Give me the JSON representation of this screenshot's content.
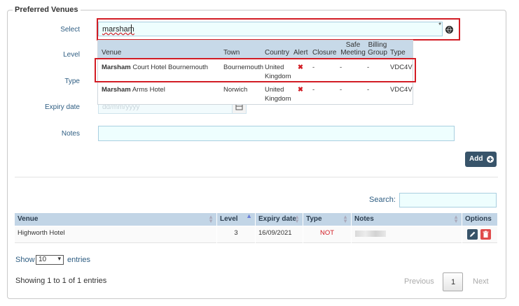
{
  "legend": "Preferred Venues",
  "form": {
    "select_label": "Select",
    "select_value": "marsham",
    "level_label": "Level",
    "type_label": "Type",
    "expiry_label": "Expiry date",
    "expiry_placeholder": "dd/mm/yyyy",
    "notes_label": "Notes",
    "add_label": "Add"
  },
  "dropdown": {
    "headers": {
      "venue": "Venue",
      "town": "Town",
      "country": "Country",
      "alert": "Alert",
      "closure": "Closure",
      "safe_meeting": "Safe Meeting",
      "billing_group": "Billing Group",
      "type": "Type"
    },
    "rows": [
      {
        "venue_bold": "Marsham",
        "venue_rest": " Court Hotel Bournemouth",
        "town": "Bournemouth",
        "country": "United Kingdom",
        "alert": "✖",
        "closure": "-",
        "safe": "-",
        "billing": "-",
        "type": "VDC4V"
      },
      {
        "venue_bold": "Marsham",
        "venue_rest": " Arms Hotel",
        "town": "Norwich",
        "country": "United Kingdom",
        "alert": "✖",
        "closure": "-",
        "safe": "-",
        "billing": "-",
        "type": "VDC4V"
      }
    ]
  },
  "table": {
    "search_label": "Search:",
    "headers": {
      "venue": "Venue",
      "level": "Level",
      "expiry": "Expiry date",
      "type": "Type",
      "notes": "Notes",
      "options": "Options"
    },
    "rows": [
      {
        "venue": "Highworth Hotel",
        "level": "3",
        "expiry": "16/09/2021",
        "type": "NOT"
      }
    ],
    "show_label": "Show",
    "show_value": "10",
    "entries_label": "entries",
    "info": "Showing 1 to 1 of 1 entries",
    "previous": "Previous",
    "page": "1",
    "next": "Next"
  },
  "colors": {
    "accent": "#d21c24",
    "header": "#c2d5e6",
    "button": "#38546a",
    "danger": "#e04b4b"
  }
}
